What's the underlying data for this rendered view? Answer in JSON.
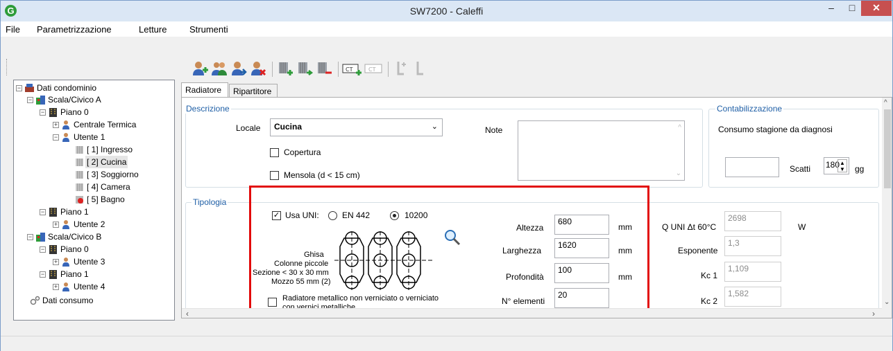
{
  "window": {
    "title": "SW7200 - Caleffi",
    "min": "–",
    "max": "□",
    "close": "✕",
    "app_icon": "G"
  },
  "menu": [
    "File",
    "Parametrizzazione",
    "Letture",
    "Strumenti"
  ],
  "toolbar_icons": [
    "add-user-icon",
    "users-icon",
    "user-arrow-icon",
    "remove-user-icon",
    "add-radiator-icon",
    "radiator-arrow-icon",
    "remove-radiator-icon",
    "ct-add-icon",
    "ct-icon",
    "valve-add-icon",
    "valve-icon"
  ],
  "tree": {
    "root": "Dati condominio",
    "scala_a": "Scala/Civico A",
    "piano0a": "Piano  0",
    "centrale": "Centrale Termica",
    "utente1": "Utente 1",
    "r1": "[ 1] Ingresso",
    "r2": "[ 2] Cucina",
    "r3": "[ 3] Soggiorno",
    "r4": "[ 4] Camera",
    "r5": "[ 5] Bagno",
    "piano1a": "Piano  1",
    "utente2": "Utente 2",
    "scala_b": "Scala/Civico B",
    "piano0b": "Piano  0",
    "utente3": "Utente 3",
    "piano1b": "Piano  1",
    "utente4": "Utente 4",
    "consumo": "Dati consumo"
  },
  "tabs": {
    "radiatore": "Radiatore",
    "ripartitore": "Ripartitore"
  },
  "descrizione": {
    "title": "Descrizione",
    "locale_label": "Locale",
    "locale_value": "Cucina",
    "copertura": "Copertura",
    "mensola": "Mensola (d < 15 cm)",
    "note_label": "Note"
  },
  "contabilizzazione": {
    "title": "Contabilizzazione",
    "consumo_label": "Consumo stagione da diagnosi",
    "scatti_label": "Scatti",
    "scatti_value": "",
    "gg_value": "180",
    "gg_label": "gg"
  },
  "tipologia": {
    "title": "Tipologia",
    "usa_uni": "Usa UNI:",
    "en442": "EN 442",
    "r10200": "10200",
    "desc1": "Ghisa",
    "desc2": "Colonne piccole",
    "desc3": "Sezione < 30 x 30 mm",
    "desc4": "Mozzo 55 mm (2)",
    "metallic1": "Radiatore metallico non verniciato o verniciato",
    "metallic2": "con vernici metalliche",
    "altezza_label": "Altezza",
    "altezza": "680",
    "larghezza_label": "Larghezza",
    "larghezza": "1620",
    "profondita_label": "Profondità",
    "profondita": "100",
    "elementi_label": "N° elementi",
    "elementi": "20",
    "unit_mm": "mm",
    "q_label": "Q UNI Δt 60°C",
    "q": "2698",
    "q_unit": "W",
    "esp_label": "Esponente",
    "esp": "1,3",
    "kc1_label": "Kc 1",
    "kc1": "1,109",
    "kc2_label": "Kc 2",
    "kc2": "1,582"
  }
}
